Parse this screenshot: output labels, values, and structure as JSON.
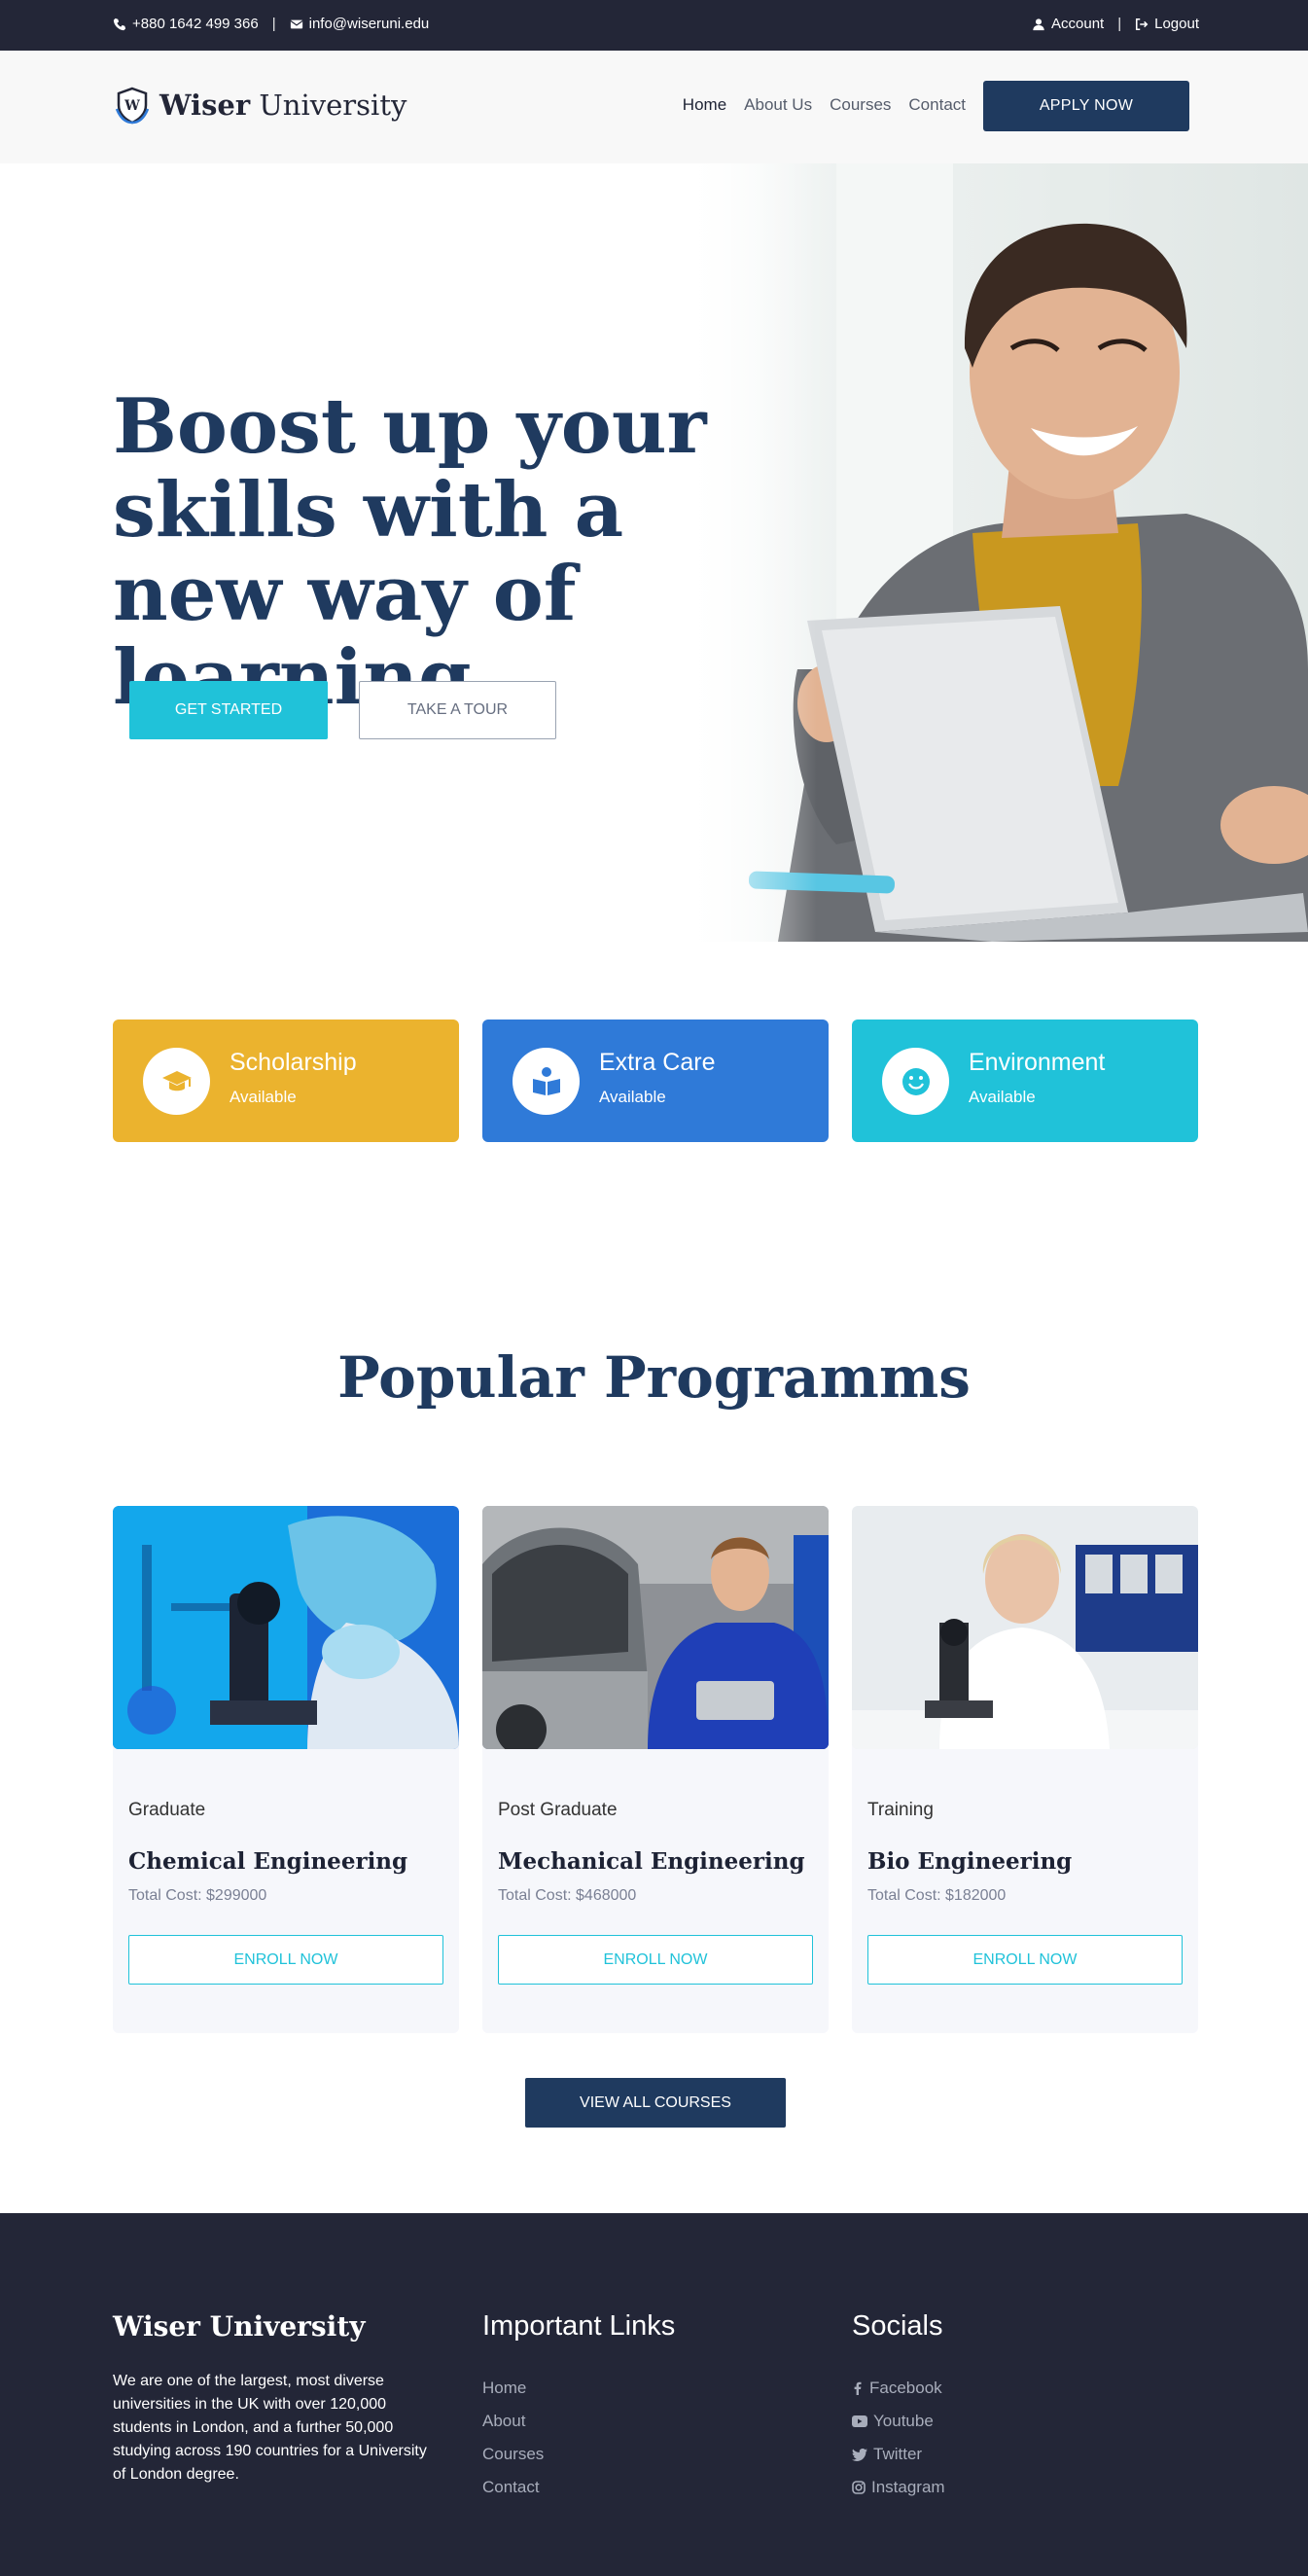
{
  "topbar": {
    "phone": "+880 1642 499 366",
    "separator": "|",
    "email": "info@wiseruni.edu",
    "account": "Account",
    "logout": "Logout"
  },
  "header": {
    "logo_bold": "Wiser",
    "logo_rest": " University",
    "nav": [
      "Home",
      "About Us",
      "Courses",
      "Contact"
    ],
    "apply": "APPLY NOW"
  },
  "hero": {
    "title": "Boost up your skills with a new way of learning.",
    "get_started": "GET STARTED",
    "take_tour": "TAKE A TOUR"
  },
  "features": [
    {
      "title": "Scholarship",
      "sub": "Available",
      "color": "#ebb32e",
      "icon": "graduation-cap-icon"
    },
    {
      "title": "Extra Care",
      "sub": "Available",
      "color": "#2f7ad8",
      "icon": "book-reader-icon"
    },
    {
      "title": "Environment",
      "sub": "Available",
      "color": "#20c2d9",
      "icon": "smile-icon"
    }
  ],
  "programs": {
    "title": "Popular Programms",
    "cards": [
      {
        "level": "Graduate",
        "title": "Chemical Engineering",
        "cost": "Total Cost: $299000",
        "enroll": "ENROLL NOW"
      },
      {
        "level": "Post Graduate",
        "title": "Mechanical Engineering",
        "cost": "Total Cost: $468000",
        "enroll": "ENROLL NOW"
      },
      {
        "level": "Training",
        "title": "Bio Engineering",
        "cost": "Total Cost: $182000",
        "enroll": "ENROLL NOW"
      }
    ],
    "view_all": "VIEW ALL COURSES"
  },
  "footer": {
    "brand": "Wiser University",
    "about": "We are one of the largest, most diverse universities in the UK with over 120,000 students in London, and a further 50,000 studying across 190 countries for a University of London degree.",
    "links_title": "Important Links",
    "links": [
      "Home",
      "About",
      "Courses",
      "Contact"
    ],
    "socials_title": "Socials",
    "socials": [
      "Facebook",
      "Youtube",
      "Twitter",
      "Instagram"
    ]
  },
  "colors": {
    "navy": "#1f3a5f",
    "dark": "#232637",
    "cyan": "#20c2d9"
  }
}
